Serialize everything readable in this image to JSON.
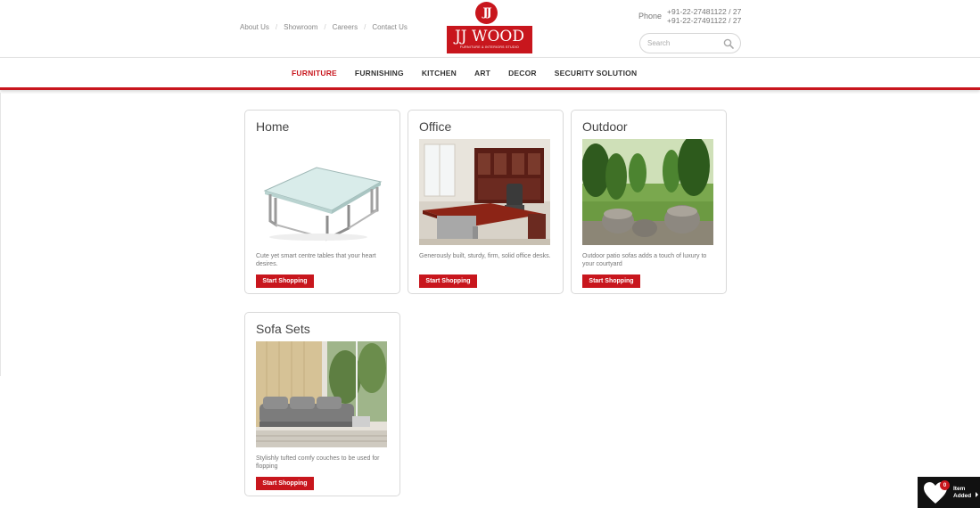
{
  "header": {
    "top_links": [
      "About Us",
      "Showroom",
      "Careers",
      "Contact Us"
    ],
    "separator": "/",
    "logo": {
      "initials": "JJ",
      "name": "JJ WOOD",
      "tagline": "FURNITURE & INTERIORS STUDIO"
    },
    "phone": {
      "label": "Phone",
      "numbers": [
        "+91-22-27481122 / 27",
        "+91-22-27491122 / 27"
      ]
    },
    "search": {
      "placeholder": "Search"
    }
  },
  "nav": {
    "items": [
      "FURNITURE",
      "FURNISHING",
      "KITCHEN",
      "ART",
      "DECOR",
      "SECURITY SOLUTION"
    ],
    "active": "FURNITURE"
  },
  "cards": [
    {
      "title": "Home",
      "description": "Cute yet smart centre tables that your heart desires.",
      "button": "Start Shopping",
      "image": "glass-coffee-table"
    },
    {
      "title": "Office",
      "description": "Generously built, sturdy, firm, solid office desks.",
      "button": "Start Shopping",
      "image": "office-desk"
    },
    {
      "title": "Outdoor",
      "description": "Outdoor patio sofas adds a touch of luxury to your courtyard",
      "button": "Start Shopping",
      "image": "outdoor-patio"
    },
    {
      "title": "Sofa Sets",
      "description": "Stylishly tufted comfy couches to be used for flopping",
      "button": "Start Shopping",
      "image": "grey-sofa"
    }
  ],
  "cart": {
    "count": "0",
    "line1": "Item",
    "line2": "Added"
  },
  "colors": {
    "brand": "#c8161d",
    "text": "#555555",
    "border": "#d9d9d9"
  }
}
